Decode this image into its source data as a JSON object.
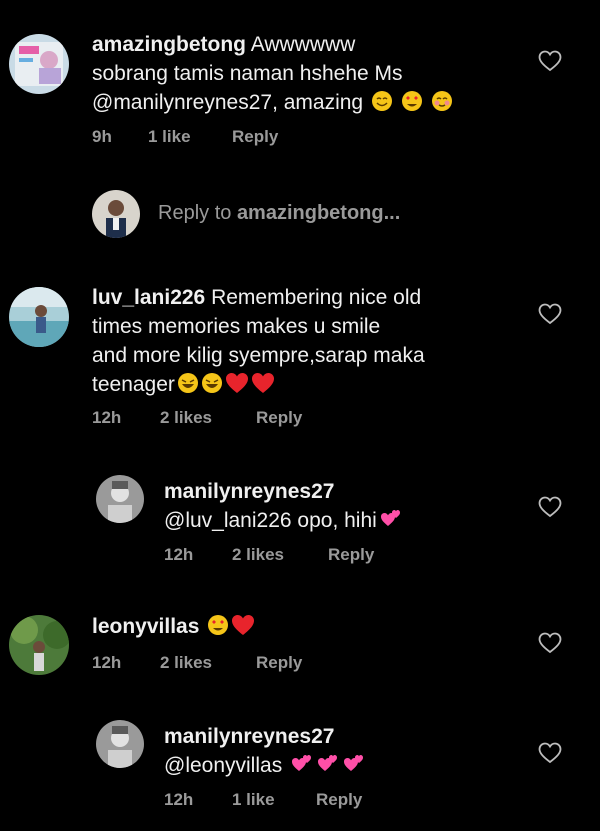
{
  "comments": [
    {
      "username": "amazingbetong",
      "text": "Awwwwww sobrang tamis naman hshehe Ms @manilynreynes27, amazing",
      "line1": "Awwwwww",
      "line2": "sobrang tamis naman hshehe Ms",
      "line3": "@manilynreynes27, amazing",
      "time": "9h",
      "likes": "1 like",
      "reply": "Reply",
      "emojis": [
        "smile-emoji",
        "heart-eyes-emoji",
        "blush-emoji"
      ]
    },
    {
      "username": "luv_lani226",
      "line1": "Remembering nice old",
      "line2": "times memories makes u smile",
      "line3": "and more kilig syempre,sarap maka",
      "line4": "teenager",
      "time": "12h",
      "likes": "2 likes",
      "reply": "Reply",
      "emojis": [
        "laugh-emoji",
        "laugh-emoji",
        "red-heart-emoji",
        "red-heart-emoji"
      ]
    },
    {
      "username": "manilynreynes27",
      "text": "@luv_lani226 opo, hihi",
      "time": "12h",
      "likes": "2 likes",
      "reply": "Reply",
      "emojis": [
        "two-hearts-emoji"
      ]
    },
    {
      "username": "leonyvillas",
      "time": "12h",
      "likes": "2 likes",
      "reply": "Reply",
      "emojis": [
        "heart-eyes-emoji",
        "red-heart-emoji"
      ]
    },
    {
      "username": "manilynreynes27",
      "text": "@leonyvillas",
      "time": "12h",
      "likes": "1 like",
      "reply": "Reply",
      "emojis": [
        "two-hearts-emoji",
        "two-hearts-emoji",
        "two-hearts-emoji"
      ]
    }
  ],
  "reply_prompt": {
    "label": "Reply to",
    "target": "amazingbetong..."
  },
  "colors": {
    "background": "#000000",
    "text": "#f0f0f0",
    "muted": "#9a9a9a",
    "heart_red": "#e8242c",
    "pink": "#ff4fa8"
  }
}
